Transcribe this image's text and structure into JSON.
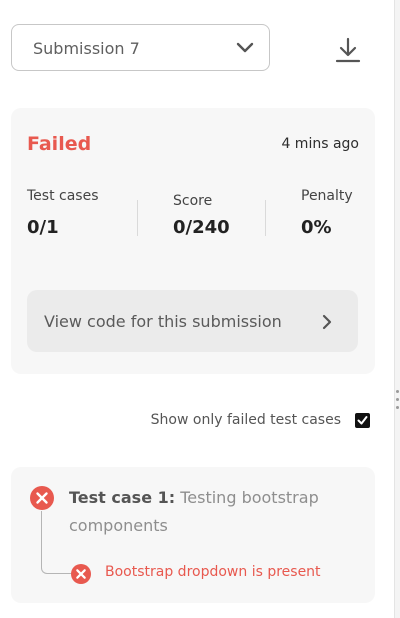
{
  "submission_select": {
    "selected": "Submission 7",
    "icon": "chevron-down-icon"
  },
  "download": {
    "icon": "download-icon"
  },
  "result": {
    "status": "Failed",
    "status_color": "#e8594f",
    "time_ago": "4 mins ago",
    "stats": [
      {
        "label": "Test cases",
        "value": "0/1"
      },
      {
        "label": "Score",
        "value": "0/240"
      },
      {
        "label": "Penalty",
        "value": "0%"
      }
    ],
    "view_code_label": "View code for this submission"
  },
  "filter": {
    "label": "Show only failed test cases",
    "checked": true
  },
  "test_case": {
    "title_prefix": "Test case 1:",
    "title_text": " Testing bootstrap components",
    "status_icon": "error-x-icon",
    "sub_items": [
      {
        "label": "Bootstrap dropdown is present",
        "status_icon": "error-x-icon"
      }
    ]
  }
}
